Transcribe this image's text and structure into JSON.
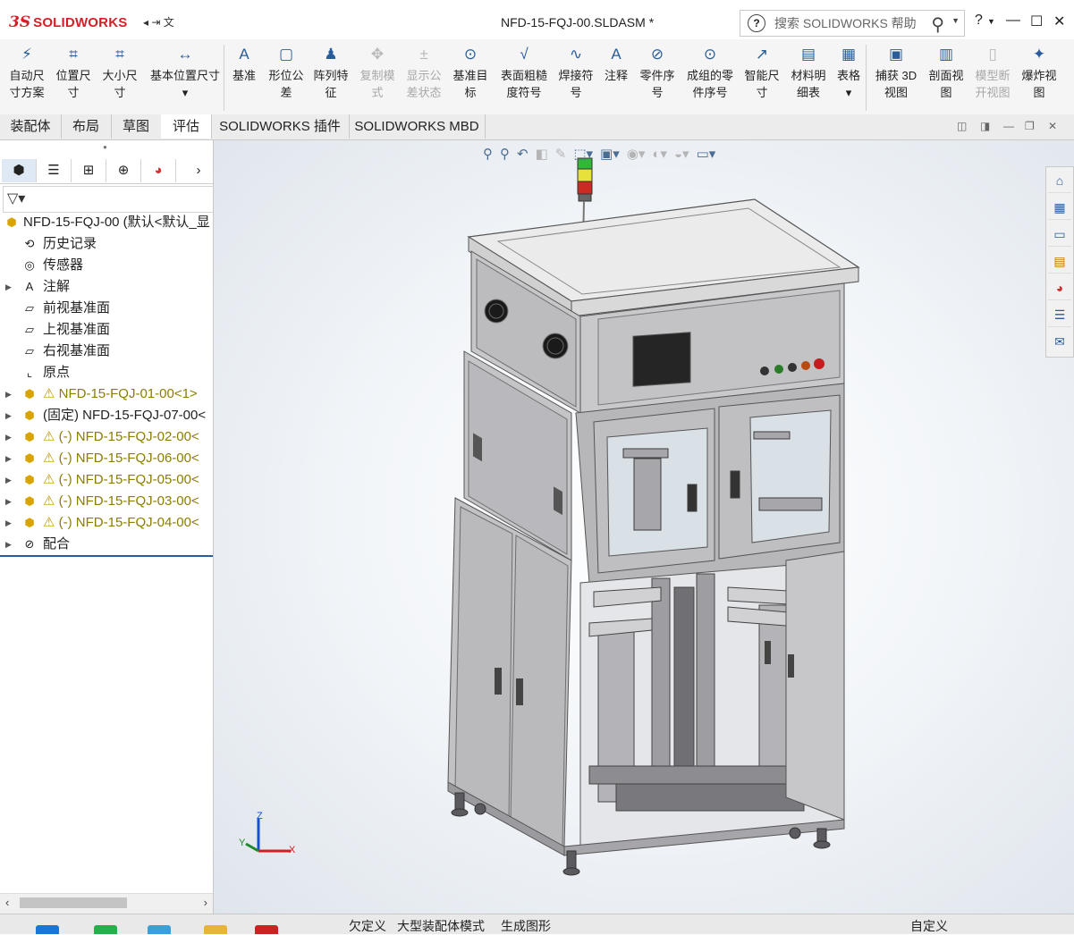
{
  "app": {
    "logo_mark": "3S",
    "logo_text": "SOLIDWORKS",
    "pin_label": "◂ ⇥ 文",
    "document_title": "NFD-15-FQJ-00.SLDASM *",
    "search_placeholder": "搜索 SOLIDWORKS 帮助",
    "help_label": "?",
    "minimize_label": "—",
    "maximize_label": "☐",
    "close_label": "✕"
  },
  "ribbon": {
    "buttons": [
      {
        "label_1": "自动尺",
        "label_2": "寸方案",
        "icon": "auto-dimension-icon",
        "enabled": true
      },
      {
        "label_1": "位置尺",
        "label_2": "寸",
        "icon": "location-dimension-icon",
        "enabled": true
      },
      {
        "label_1": "大小尺",
        "label_2": "寸",
        "icon": "size-dimension-icon",
        "enabled": true
      },
      {
        "label_1": "基本位置尺寸",
        "label_2": "▾",
        "icon": "basic-location-dimension-icon",
        "enabled": true
      },
      {
        "label_1": "基准",
        "label_2": "",
        "icon": "datum-icon",
        "enabled": true
      },
      {
        "label_1": "形位公",
        "label_2": "差",
        "icon": "geometric-tolerance-icon",
        "enabled": true
      },
      {
        "label_1": "阵列特",
        "label_2": "征",
        "icon": "pattern-feature-icon",
        "enabled": true
      },
      {
        "label_1": "复制模",
        "label_2": "式",
        "icon": "copy-scheme-icon",
        "enabled": false
      },
      {
        "label_1": "显示公",
        "label_2": "差状态",
        "icon": "show-tolerance-status-icon",
        "enabled": false
      },
      {
        "label_1": "基准目",
        "label_2": "标",
        "icon": "datum-target-icon",
        "enabled": true
      },
      {
        "label_1": "表面粗糙",
        "label_2": "度符号",
        "icon": "surface-finish-icon",
        "enabled": true
      },
      {
        "label_1": "焊接符",
        "label_2": "号",
        "icon": "weld-symbol-icon",
        "enabled": true
      },
      {
        "label_1": "注释",
        "label_2": "",
        "icon": "note-icon",
        "enabled": true
      },
      {
        "label_1": "零件序",
        "label_2": "号",
        "icon": "balloon-icon",
        "enabled": true
      },
      {
        "label_1": "成组的零",
        "label_2": "件序号",
        "icon": "stacked-balloon-icon",
        "enabled": true
      },
      {
        "label_1": "智能尺",
        "label_2": "寸",
        "icon": "smart-dimension-icon",
        "enabled": true
      },
      {
        "label_1": "材料明",
        "label_2": "细表",
        "icon": "bom-icon",
        "enabled": true
      },
      {
        "label_1": "表格",
        "label_2": "▾",
        "icon": "table-icon",
        "enabled": true
      },
      {
        "label_1": "捕获 3D",
        "label_2": "视图",
        "icon": "capture-3d-view-icon",
        "enabled": true
      },
      {
        "label_1": "剖面视",
        "label_2": "图",
        "icon": "section-view-icon",
        "enabled": true
      },
      {
        "label_1": "模型断",
        "label_2": "开视图",
        "icon": "model-break-view-icon",
        "enabled": false
      },
      {
        "label_1": "爆炸视",
        "label_2": "图",
        "icon": "exploded-view-icon",
        "enabled": true
      }
    ]
  },
  "tabs": [
    {
      "label": "装配体",
      "active": false
    },
    {
      "label": "布局",
      "active": false
    },
    {
      "label": "草图",
      "active": false
    },
    {
      "label": "评估",
      "active": true
    },
    {
      "label": "SOLIDWORKS 插件",
      "active": false
    },
    {
      "label": "SOLIDWORKS MBD",
      "active": false
    }
  ],
  "feature_tree": {
    "filter_label": "▽▾",
    "root": "NFD-15-FQJ-00  (默认<默认_显",
    "items": [
      {
        "label": "历史记录",
        "icon": "history-icon",
        "expandable": false,
        "warning": false
      },
      {
        "label": "传感器",
        "icon": "sensor-icon",
        "expandable": false,
        "warning": false
      },
      {
        "label": "注解",
        "icon": "annotation-icon",
        "expandable": true,
        "warning": false
      },
      {
        "label": "前视基准面",
        "icon": "plane-icon",
        "expandable": false,
        "warning": false
      },
      {
        "label": "上视基准面",
        "icon": "plane-icon",
        "expandable": false,
        "warning": false
      },
      {
        "label": "右视基准面",
        "icon": "plane-icon",
        "expandable": false,
        "warning": false
      },
      {
        "label": "原点",
        "icon": "origin-icon",
        "expandable": false,
        "warning": false
      },
      {
        "label": "NFD-15-FQJ-01-00<1>",
        "icon": "subassembly-icon",
        "expandable": true,
        "warning": true
      },
      {
        "label": "(固定) NFD-15-FQJ-07-00<",
        "icon": "subassembly-icon",
        "expandable": true,
        "warning": false
      },
      {
        "label": "(-) NFD-15-FQJ-02-00<",
        "icon": "subassembly-icon",
        "expandable": true,
        "warning": true
      },
      {
        "label": "(-) NFD-15-FQJ-06-00<",
        "icon": "subassembly-icon",
        "expandable": true,
        "warning": true
      },
      {
        "label": "(-) NFD-15-FQJ-05-00<",
        "icon": "subassembly-icon",
        "expandable": true,
        "warning": true
      },
      {
        "label": "(-) NFD-15-FQJ-03-00<",
        "icon": "subassembly-icon",
        "expandable": true,
        "warning": true
      },
      {
        "label": "(-) NFD-15-FQJ-04-00<",
        "icon": "subassembly-icon",
        "expandable": true,
        "warning": true
      },
      {
        "label": "配合",
        "icon": "mates-icon",
        "expandable": true,
        "warning": false
      }
    ]
  },
  "triad": {
    "x": "X",
    "y": "Y",
    "z": "Z"
  },
  "status_bar": {
    "item1": "欠定义",
    "item2": "大型装配体模式",
    "item3": "生成图形",
    "item4": "自定义"
  }
}
